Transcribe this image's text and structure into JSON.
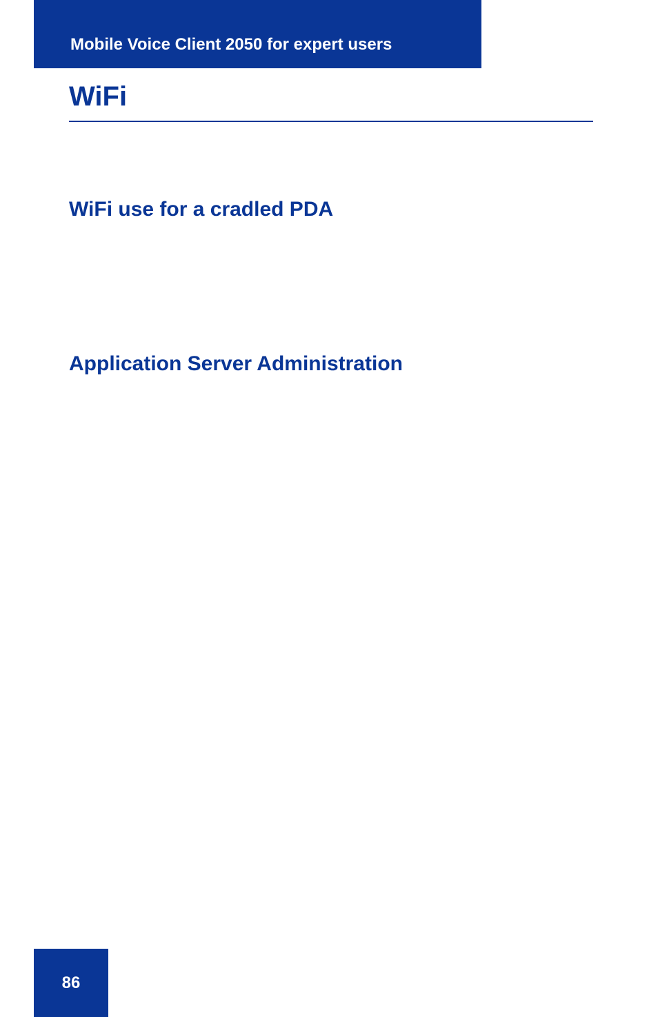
{
  "header": {
    "title": "Mobile Voice Client 2050 for expert users"
  },
  "content": {
    "main_heading": "WiFi",
    "sub_heading_1": "WiFi use for a cradled PDA",
    "sub_heading_2": "Application Server Administration"
  },
  "footer": {
    "page_number": "86"
  },
  "colors": {
    "brand_blue": "#0a3696"
  }
}
